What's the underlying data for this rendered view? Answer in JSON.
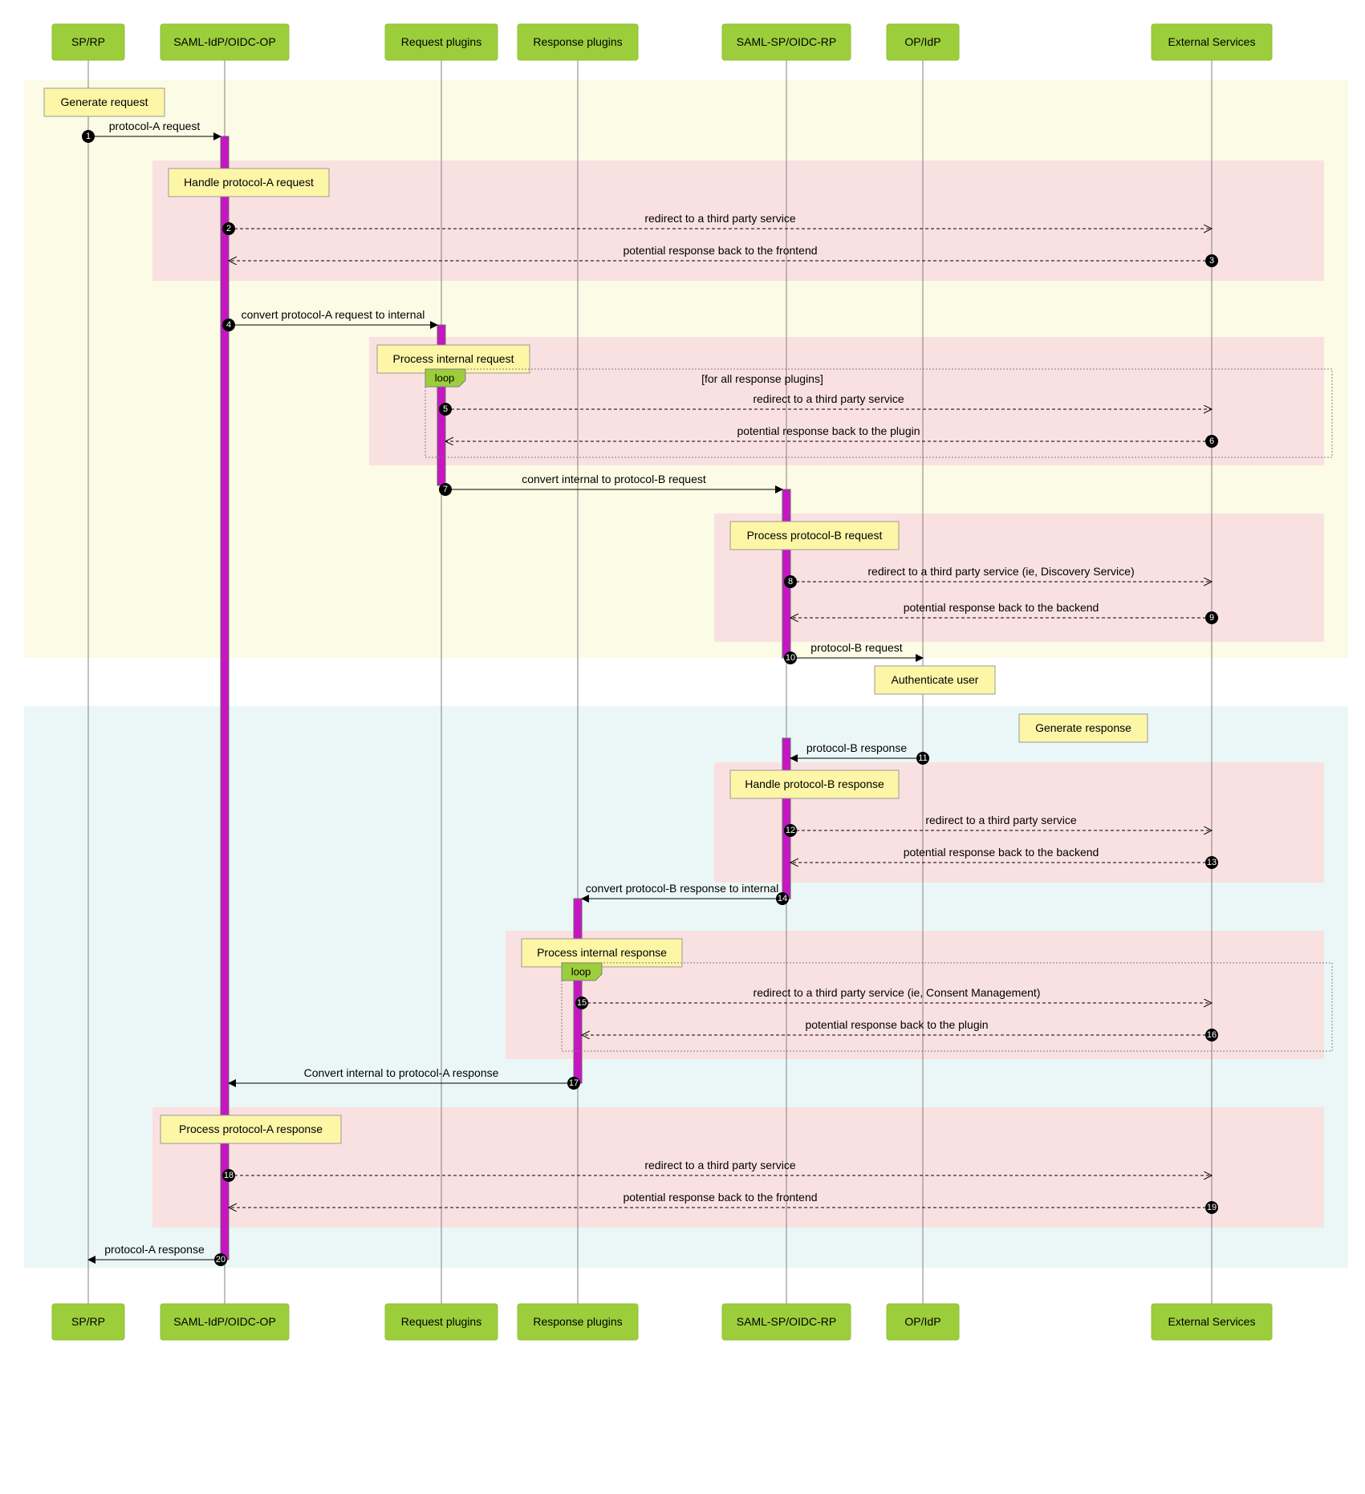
{
  "actors": [
    {
      "id": "sp",
      "label": "SP/RP"
    },
    {
      "id": "idp",
      "label": "SAML-IdP/OIDC-OP"
    },
    {
      "id": "reqp",
      "label": "Request plugins"
    },
    {
      "id": "resp",
      "label": "Response plugins"
    },
    {
      "id": "rp",
      "label": "SAML-SP/OIDC-RP"
    },
    {
      "id": "op",
      "label": "OP/IdP"
    },
    {
      "id": "ext",
      "label": "External Services"
    }
  ],
  "notes": {
    "gen_req": "Generate request",
    "handle_a": "Handle protocol-A request",
    "proc_int_req": "Process internal request",
    "proc_b_req": "Process protocol-B request",
    "auth_user": "Authenticate user",
    "gen_resp": "Generate response",
    "handle_b_resp": "Handle protocol-B response",
    "proc_int_resp": "Process internal response",
    "proc_a_resp": "Process protocol-A response"
  },
  "messages": {
    "m1": "protocol-A request",
    "m2": "redirect to a third party service",
    "m3": "potential response back to the frontend",
    "m4": "convert protocol-A request to internal",
    "m5": "redirect to a third party service",
    "m6": "potential response back to the plugin",
    "m7": "convert internal to protocol-B request",
    "m8": "redirect to a third party service (ie, Discovery Service)",
    "m9": "potential response back to the backend",
    "m10": "protocol-B request",
    "m11": "protocol-B response",
    "m12": "redirect to a third party service",
    "m13": "potential response back to the backend",
    "m14": "convert protocol-B response to internal",
    "m15": "redirect to a third party service (ie, Consent Management)",
    "m16": "potential response back to the plugin",
    "m17": "Convert internal to protocol-A response",
    "m18": "redirect to a third party service",
    "m19": "potential response back to the frontend",
    "m20": "protocol-A response"
  },
  "loops": {
    "loop_label": "loop",
    "cond1": "[for all response plugins]"
  }
}
